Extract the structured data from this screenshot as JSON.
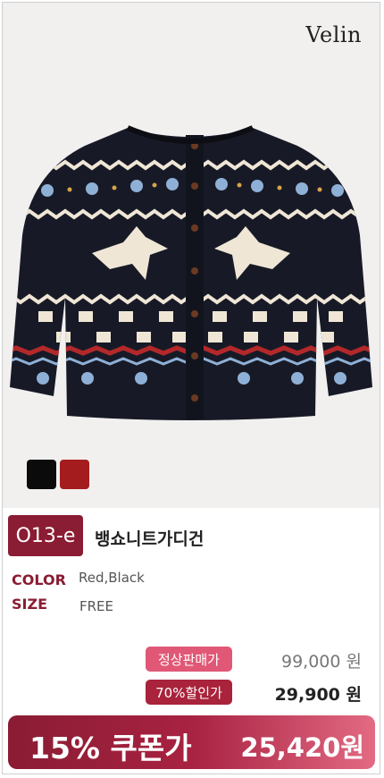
{
  "brand": {
    "logo_text": "Velin"
  },
  "color_swatches": [
    {
      "name": "Black",
      "color": "#0b0b0b"
    },
    {
      "name": "Red",
      "color": "#a51c1e"
    }
  ],
  "product": {
    "code": "O13-e",
    "name": "뱅쇼니트가디건",
    "color_label": "COLOR",
    "color_value": "Red,Black",
    "size_label": "SIZE",
    "size_value": "FREE"
  },
  "pricing": {
    "regular_label": "정상판매가",
    "regular_price": "99,000 원",
    "discount_label": "70%할인가",
    "discount_price": "29,900 원",
    "coupon_label": "15% 쿠폰가",
    "coupon_price": "25,420원"
  },
  "theme": {
    "accent": "#8a1c33",
    "pink": "#e05876",
    "knit_navy": "#171a26",
    "knit_cream": "#efe6d6",
    "knit_red": "#b3282a",
    "knit_blue": "#8fb0d6"
  }
}
